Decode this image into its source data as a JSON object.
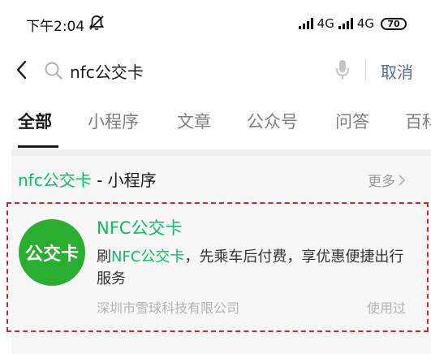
{
  "status_bar": {
    "time": "下午2:04",
    "network_1": "4G",
    "network_2": "4G",
    "battery": "70"
  },
  "search": {
    "query": "nfc公交卡",
    "cancel_label": "取消"
  },
  "tabs": [
    {
      "label": "全部",
      "active": true
    },
    {
      "label": "小程序"
    },
    {
      "label": "文章"
    },
    {
      "label": "公众号"
    },
    {
      "label": "问答"
    },
    {
      "label": "百科"
    }
  ],
  "section": {
    "title_highlight": "nfc公交卡",
    "title_suffix": " - 小程序",
    "more_label": "更多"
  },
  "result": {
    "logo_text": "公交卡",
    "name": "NFC公交卡",
    "desc_prefix": "刷",
    "desc_highlight": "NFC公交卡",
    "desc_suffix": "，先乘车后付费，享优惠便捷出行服务",
    "company": "深圳市雪球科技有限公司",
    "used_label": "使用过"
  },
  "colors": {
    "accent_green": "#07c160",
    "link_blue": "#576b95",
    "logo_green": "#2aae2f",
    "highlight_border": "#d9262b"
  }
}
